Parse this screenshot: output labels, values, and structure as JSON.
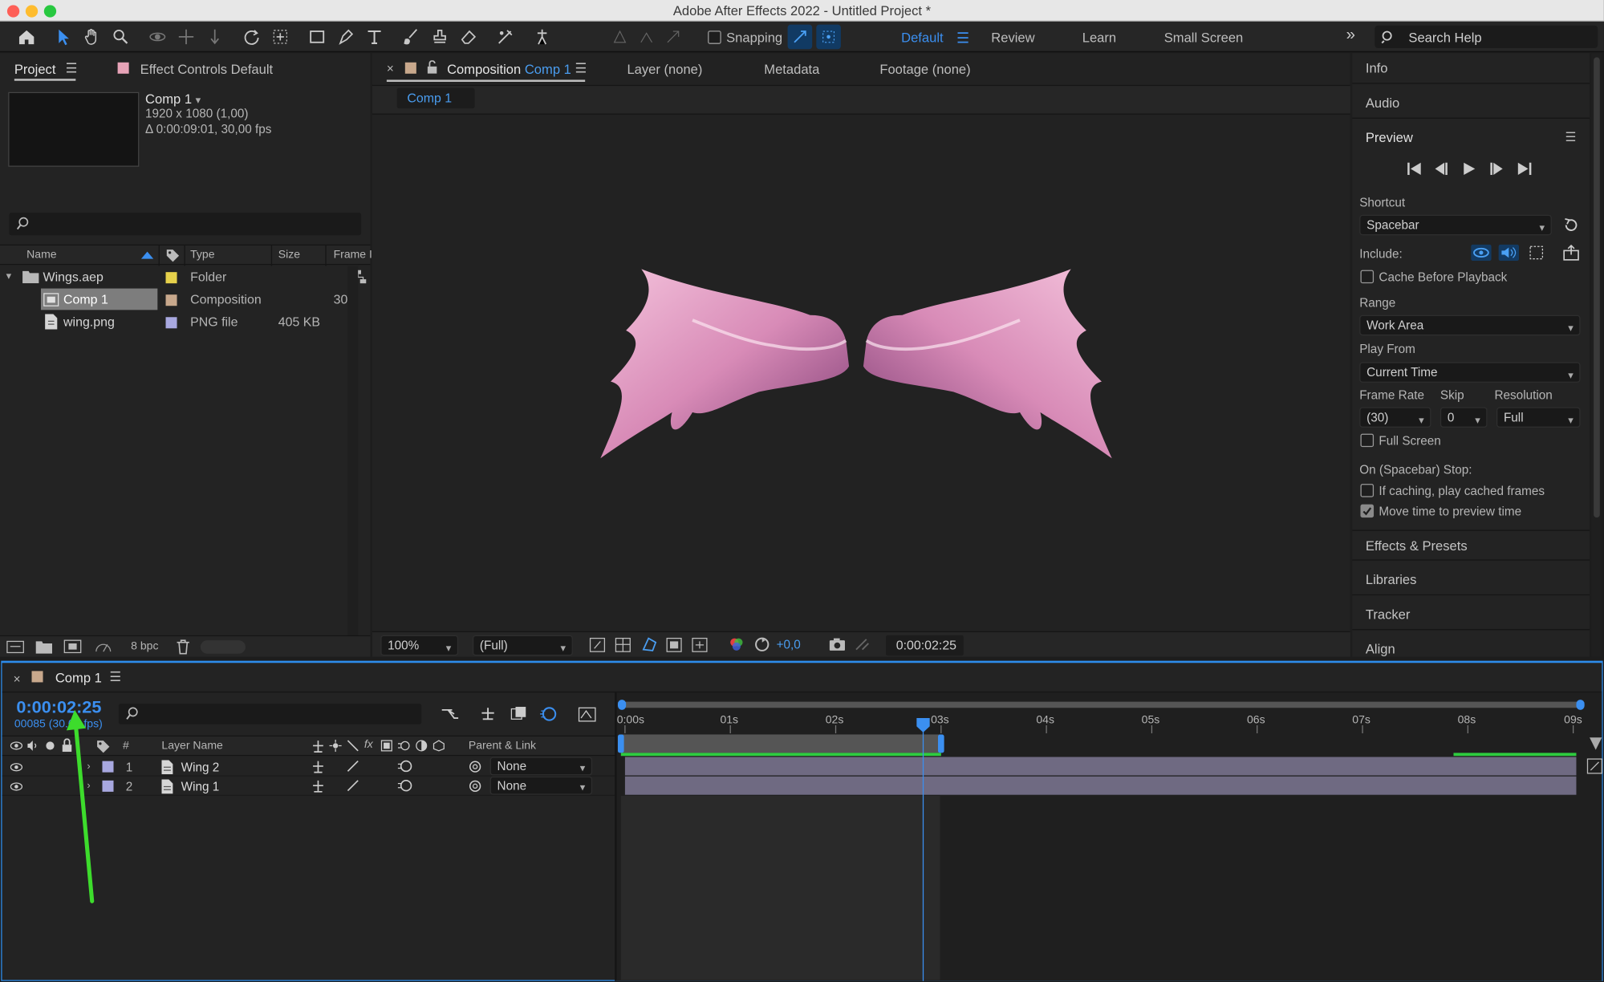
{
  "window": {
    "title": "Adobe After Effects 2022 - Untitled Project *"
  },
  "toolbar": {
    "snapping_label": "Snapping",
    "workspaces": [
      "Default",
      "Review",
      "Learn",
      "Small Screen"
    ],
    "search_placeholder": "Search Help"
  },
  "project": {
    "tab_project": "Project",
    "tab_effect_controls": "Effect Controls Default",
    "thumb_name": "Comp 1",
    "thumb_size": "1920 x 1080 (1,00)",
    "thumb_duration": "Δ 0:00:09:01, 30,00 fps",
    "columns": {
      "name": "Name",
      "type": "Type",
      "size": "Size",
      "frame": "Frame I"
    },
    "rows": [
      {
        "name": "Wings.aep",
        "type": "Folder",
        "size": "",
        "frame": ""
      },
      {
        "name": "Comp 1",
        "type": "Composition",
        "size": "",
        "frame": "30"
      },
      {
        "name": "wing.png",
        "type": "PNG file",
        "size": "405 KB",
        "frame": ""
      }
    ],
    "bpc": "8 bpc"
  },
  "viewer": {
    "tab_prefix": "Composition",
    "tab_comp": "Comp 1",
    "tab_layer": "Layer (none)",
    "tab_metadata": "Metadata",
    "tab_footage": "Footage (none)",
    "comp_chip": "Comp 1",
    "zoom": "100%",
    "resolution": "(Full)",
    "exposure": "+0,0",
    "timecode": "0:00:02:25"
  },
  "right": {
    "info": "Info",
    "audio": "Audio",
    "preview": "Preview",
    "shortcut_label": "Shortcut",
    "shortcut_value": "Spacebar",
    "include_label": "Include:",
    "cache_label": "Cache Before Playback",
    "range_label": "Range",
    "range_value": "Work Area",
    "playfrom_label": "Play From",
    "playfrom_value": "Current Time",
    "framerate_label": "Frame Rate",
    "skip_label": "Skip",
    "resolution_label": "Resolution",
    "framerate_value": "(30)",
    "skip_value": "0",
    "resolution_value": "Full",
    "fullscreen_label": "Full Screen",
    "stop_label": "On (Spacebar) Stop:",
    "ifcaching_label": "If caching, play cached frames",
    "movetime_label": "Move time to preview time",
    "effects": "Effects & Presets",
    "libraries": "Libraries",
    "tracker": "Tracker",
    "align": "Align"
  },
  "timeline": {
    "tab": "Comp 1",
    "timecode": "0:00:02:25",
    "frames": "00085 (30.00 fps)",
    "col_num": "#",
    "col_layer": "Layer Name",
    "col_parent": "Parent & Link",
    "layers": [
      {
        "num": "1",
        "name": "Wing 2",
        "parent": "None"
      },
      {
        "num": "2",
        "name": "Wing 1",
        "parent": "None"
      }
    ],
    "ruler": [
      "0:00s",
      "01s",
      "02s",
      "03s",
      "04s",
      "05s",
      "06s",
      "07s",
      "08s",
      "09s"
    ]
  },
  "colors": {
    "accent": "#2d8ceb",
    "highlight": "#4a9df0",
    "annotation_arrow": "#3ddc2c"
  }
}
